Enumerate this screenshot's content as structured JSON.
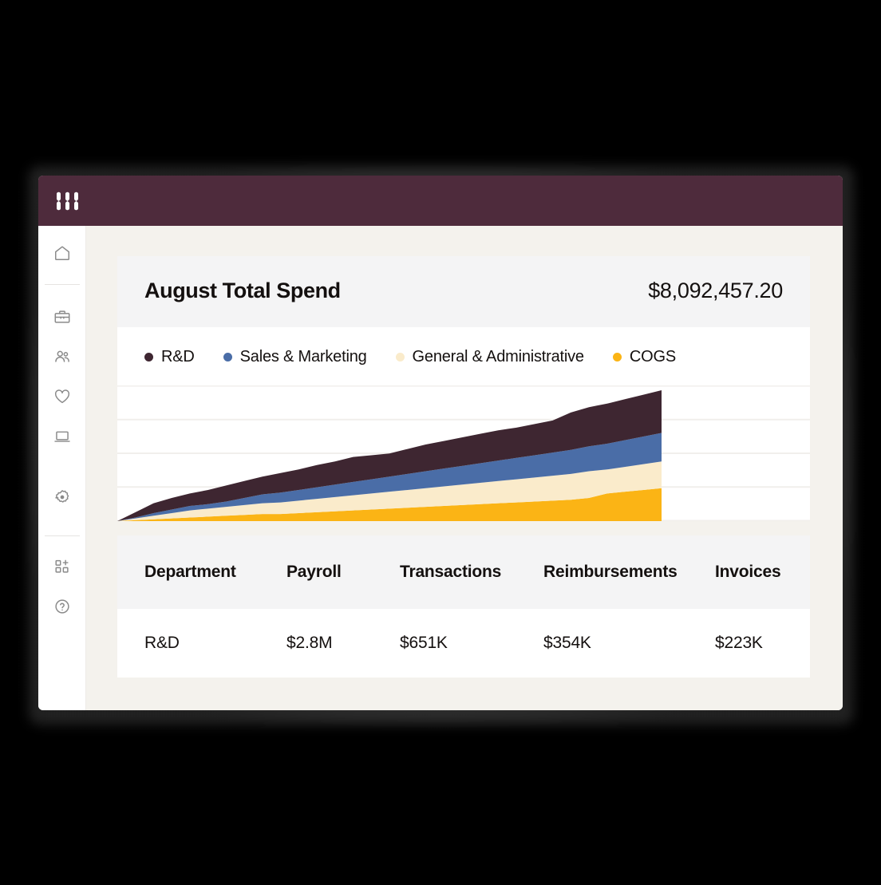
{
  "window": {
    "brand_logo_name": "ramp-logo"
  },
  "sidebar": {
    "items": [
      {
        "icon": "home-icon",
        "name": "sidebar-item-home"
      },
      {
        "icon": "briefcase-icon",
        "name": "sidebar-item-business"
      },
      {
        "icon": "people-icon",
        "name": "sidebar-item-people"
      },
      {
        "icon": "heart-icon",
        "name": "sidebar-item-perks"
      },
      {
        "icon": "laptop-icon",
        "name": "sidebar-item-devices"
      },
      {
        "icon": "gear-icon",
        "name": "sidebar-item-settings"
      },
      {
        "icon": "add-widget-icon",
        "name": "sidebar-item-add-app"
      },
      {
        "icon": "help-icon",
        "name": "sidebar-item-help"
      }
    ]
  },
  "spend_card": {
    "title": "August Total Spend",
    "amount": "$8,092,457.20"
  },
  "chart_data": {
    "type": "area",
    "stacked": true,
    "title": "August Total Spend",
    "xlabel": "",
    "ylabel": "",
    "grid": true,
    "gridlines": 5,
    "legend_position": "top",
    "colors": {
      "R&D": "#3E2631",
      "Sales & Marketing": "#4A6DA7",
      "General & Administrative": "#FAEBCB",
      "COGS": "#FBB415"
    },
    "x": [
      0,
      1,
      2,
      3,
      4,
      5,
      6,
      7,
      8,
      9,
      10,
      11,
      12,
      13,
      14,
      15,
      16,
      17,
      18,
      19,
      20,
      21,
      22,
      23,
      24,
      25,
      26,
      27,
      28,
      29,
      30
    ],
    "series": [
      {
        "name": "COGS",
        "values": [
          0,
          1,
          2,
          3,
          4,
          5,
          6,
          7,
          8,
          8,
          9,
          10,
          11,
          12,
          13,
          14,
          15,
          16,
          17,
          18,
          19,
          20,
          21,
          22,
          23,
          24,
          26,
          31,
          33,
          35,
          37
        ]
      },
      {
        "name": "General & Administrative",
        "values": [
          0,
          2,
          4,
          6,
          8,
          9,
          10,
          11,
          12,
          13,
          14,
          15,
          16,
          17,
          18,
          19,
          20,
          21,
          22,
          23,
          24,
          25,
          26,
          27,
          28,
          29,
          30,
          27,
          28,
          29,
          30
        ]
      },
      {
        "name": "Sales & Marketing",
        "values": [
          0,
          1,
          3,
          4,
          5,
          5,
          6,
          8,
          10,
          11,
          12,
          13,
          14,
          15,
          16,
          17,
          18,
          19,
          20,
          21,
          22,
          23,
          24,
          25,
          26,
          27,
          28,
          29,
          30,
          31,
          32
        ]
      },
      {
        "name": "R&D",
        "values": [
          0,
          6,
          11,
          13,
          14,
          16,
          18,
          19,
          20,
          22,
          23,
          25,
          26,
          28,
          27,
          26,
          28,
          30,
          31,
          32,
          33,
          34,
          34,
          35,
          36,
          42,
          44,
          45,
          46,
          47,
          48
        ]
      }
    ],
    "legend": [
      {
        "label": "R&D",
        "color": "#3E2631"
      },
      {
        "label": "Sales & Marketing",
        "color": "#4A6DA7"
      },
      {
        "label": "General & Administrative",
        "color": "#FAEBCB"
      },
      {
        "label": "COGS",
        "color": "#FBB415"
      }
    ]
  },
  "table": {
    "columns": [
      "Department",
      "Payroll",
      "Transactions",
      "Reimbursements",
      "Invoices"
    ],
    "rows": [
      {
        "department": "R&D",
        "payroll": "$2.8M",
        "transactions": "$651K",
        "reimbursements": "$354K",
        "invoices": "$223K"
      }
    ]
  }
}
